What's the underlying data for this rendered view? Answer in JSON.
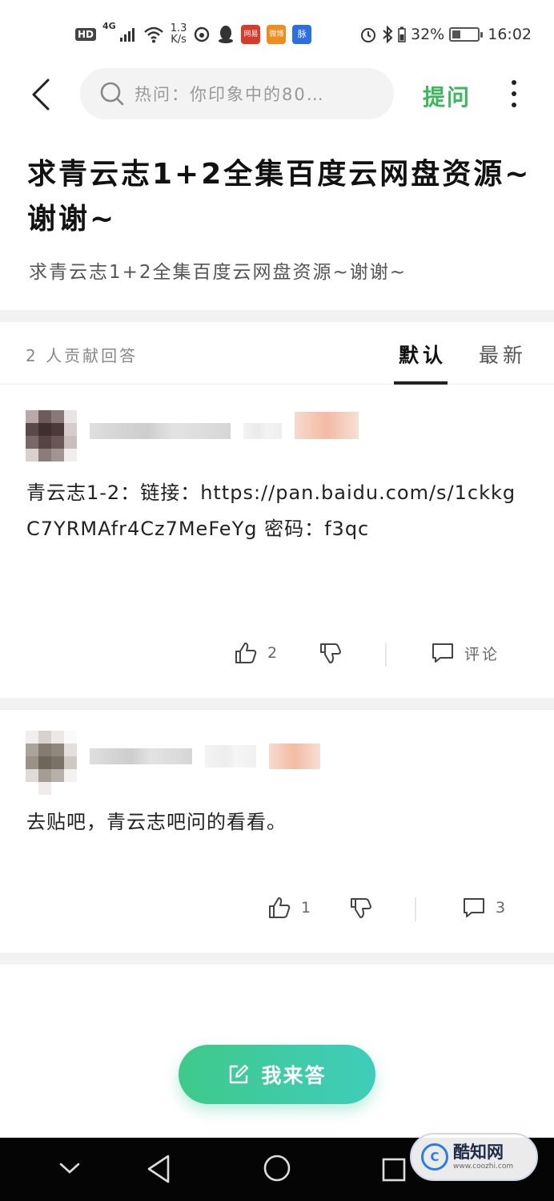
{
  "status_bar": {
    "hd": "HD",
    "network": "4G",
    "speed": "1.3\nK/s",
    "app_badges": [
      {
        "label": "网易",
        "color": "#d93b2b"
      },
      {
        "label": "微博",
        "color": "#f08c1e"
      },
      {
        "label": "脉",
        "color": "#2c6fe0"
      }
    ],
    "battery_pct": "32%",
    "battery_level": 0.32,
    "time": "16:02"
  },
  "header": {
    "search_placeholder": "热问：你印象中的80…",
    "ask_label": "提问"
  },
  "question": {
    "title": "求青云志1+2全集百度云网盘资源~谢谢~",
    "desc": "求青云志1+2全集百度云网盘资源~谢谢~"
  },
  "answers_header": {
    "count_text": "2 人贡献回答",
    "sort_default": "默认",
    "sort_latest": "最新"
  },
  "answers": [
    {
      "text": "青云志1-2：链接：https://pan.baidu.com/s/1ckkgC7YRMAfr4Cz7MeFeYg 密码：f3qc",
      "likes": "2",
      "comment_label": "评论"
    },
    {
      "text": "去贴吧，青云志吧问的看看。",
      "likes": "1",
      "comment_label": "3"
    }
  ],
  "fab": {
    "label": "我来答"
  },
  "watermark": {
    "name": "酷知网",
    "url": "www.coozhi.com",
    "logo": "C"
  },
  "colors": {
    "accent_green": "#3cb85c",
    "fab_start": "#3fc98a",
    "fab_end": "#3fcdbb"
  }
}
